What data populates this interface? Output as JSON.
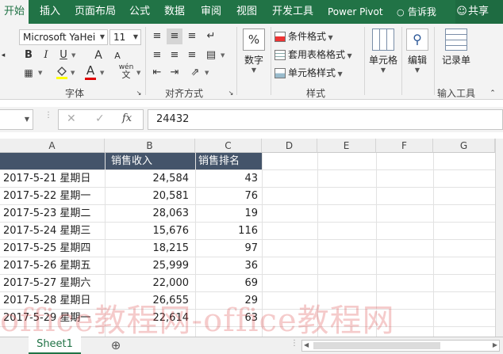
{
  "ribbon_tabs": [
    "开始",
    "插入",
    "页面布局",
    "公式",
    "数据",
    "审阅",
    "视图",
    "开发工具",
    "Power Pivot"
  ],
  "tell_me": "告诉我",
  "share": "共享",
  "font": {
    "name": "Microsoft YaHei",
    "size": "11",
    "group_label": "字体",
    "bold": "B",
    "italic": "I",
    "underline": "U",
    "grow": "A",
    "shrink": "A",
    "font_color_glyph": "A",
    "phonetic": "wén"
  },
  "alignment": {
    "group_label": "对齐方式"
  },
  "number": {
    "label": "数字",
    "glyph": "%"
  },
  "styles": {
    "group_label": "样式",
    "conditional": "条件格式",
    "table_format": "套用表格格式",
    "cell_styles": "单元格样式"
  },
  "cells_btn": "单元格",
  "edit_btn": "编辑",
  "input_tools": {
    "record": "记录单",
    "group_label": "输入工具"
  },
  "formula_bar": {
    "fx": "fx",
    "value": "24432"
  },
  "columns": [
    "A",
    "B",
    "C",
    "D",
    "E",
    "F",
    "G"
  ],
  "headers": [
    "",
    "销售收入",
    "销售排名"
  ],
  "rows": [
    [
      "2017-5-21 星期日",
      "24,584",
      "43"
    ],
    [
      "2017-5-22 星期一",
      "20,581",
      "76"
    ],
    [
      "2017-5-23 星期二",
      "28,063",
      "19"
    ],
    [
      "2017-5-24 星期三",
      "15,676",
      "116"
    ],
    [
      "2017-5-25 星期四",
      "18,215",
      "97"
    ],
    [
      "2017-5-26 星期五",
      "25,999",
      "36"
    ],
    [
      "2017-5-27 星期六",
      "22,000",
      "69"
    ],
    [
      "2017-5-28 星期日",
      "26,655",
      "29"
    ],
    [
      "2017-5-29 星期一",
      "22,614",
      "63"
    ]
  ],
  "sheet_tab": "Sheet1",
  "add_sheet": "⊕",
  "watermark": "office教程网-office教程网",
  "colors": {
    "excel_green": "#217346",
    "header_fill": "#44546a"
  }
}
